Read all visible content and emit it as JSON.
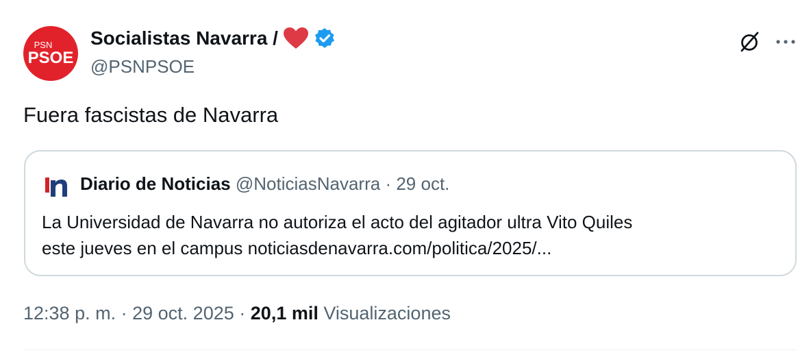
{
  "author": {
    "name": "Socialistas Navarra /",
    "handle": "@PSNPSOE",
    "avatar_top": "PSN",
    "avatar_main": "PSOE",
    "avatar_color": "#e2222b",
    "heart_color": "#e0245e",
    "verified_color": "#1d9bf0"
  },
  "tweet": {
    "text": "Fuera fascistas de Navarra"
  },
  "quote": {
    "name": "Diario de Noticias",
    "handle": "@NoticiasNavarra",
    "separator": "·",
    "date": "29 oct.",
    "body_line1": "La Universidad de Navarra no autoriza el acto del agitador ultra Vito Quiles",
    "body_line2": "este jueves en el campus noticiasdenavarra.com/politica/2025/..."
  },
  "footer": {
    "time": "12:38 p. m.",
    "separator": "·",
    "date": "29 oct. 2025",
    "views_count": "20,1 mil",
    "views_label": "Visualizaciones"
  },
  "icons": {
    "grok": "grok-icon",
    "more": "more-icon",
    "heart": "heart-icon",
    "verified": "verified-badge-icon",
    "quote_logo": "diario-de-noticias-logo"
  }
}
